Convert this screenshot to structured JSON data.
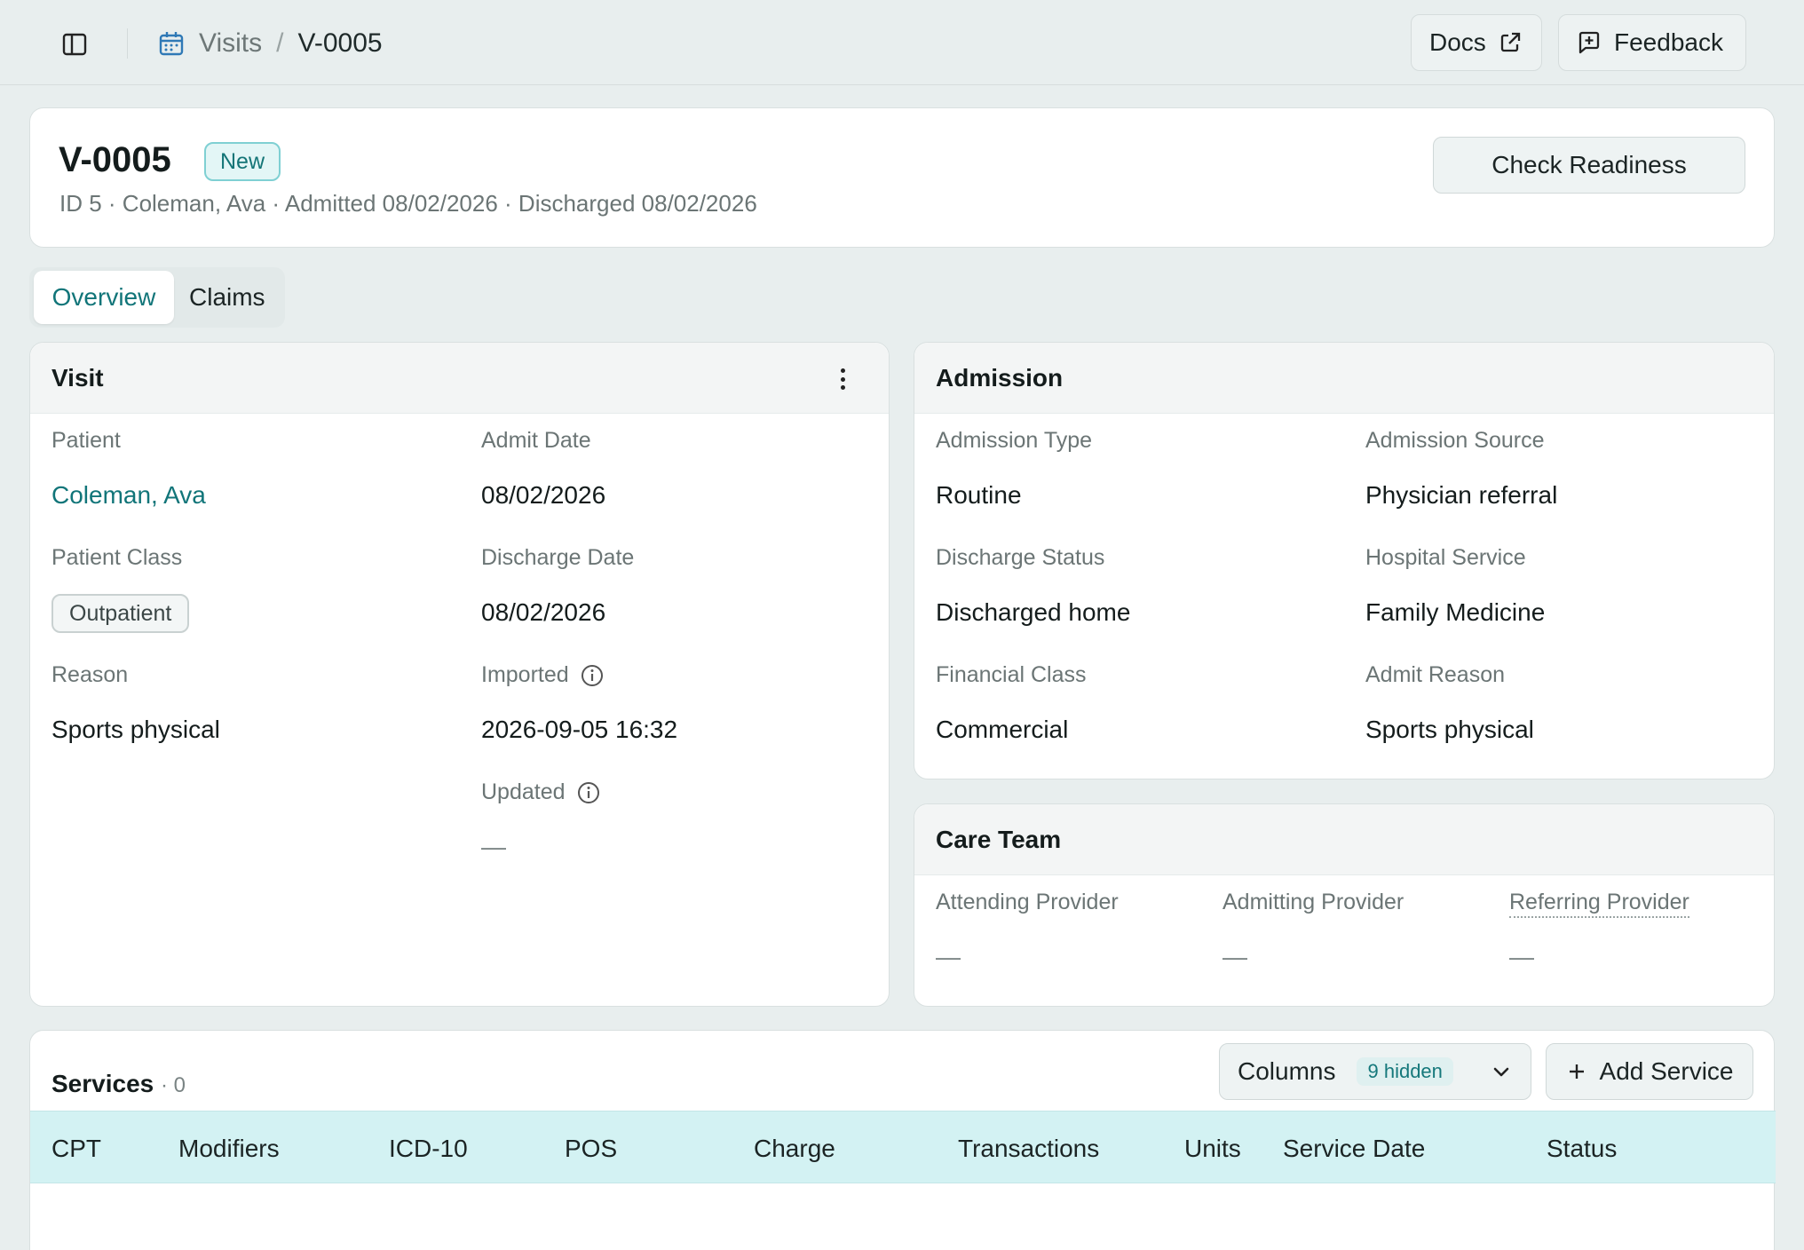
{
  "topbar": {
    "breadcrumb": {
      "section": "Visits",
      "separator": "/",
      "current": "V-0005"
    },
    "docs_label": "Docs",
    "feedback_label": "Feedback"
  },
  "header": {
    "title": "V-0005",
    "status_badge": "New",
    "subtitle": "ID 5 · Coleman, Ava · Admitted 08/02/2026 · Discharged 08/02/2026",
    "check_readiness_label": "Check Readiness"
  },
  "tabs": [
    {
      "label": "Overview",
      "active": true
    },
    {
      "label": "Claims",
      "active": false
    }
  ],
  "visit": {
    "title": "Visit",
    "patient_label": "Patient",
    "patient_value": "Coleman, Ava",
    "admit_date_label": "Admit Date",
    "admit_date_value": "08/02/2026",
    "patient_class_label": "Patient Class",
    "patient_class_value": "Outpatient",
    "discharge_date_label": "Discharge Date",
    "discharge_date_value": "08/02/2026",
    "reason_label": "Reason",
    "reason_value": "Sports physical",
    "imported_label": "Imported",
    "imported_value": "2026-09-05 16:32",
    "updated_label": "Updated",
    "updated_value": "—"
  },
  "admission": {
    "title": "Admission",
    "admission_type_label": "Admission Type",
    "admission_type_value": "Routine",
    "admission_source_label": "Admission Source",
    "admission_source_value": "Physician referral",
    "discharge_status_label": "Discharge Status",
    "discharge_status_value": "Discharged home",
    "hospital_service_label": "Hospital Service",
    "hospital_service_value": "Family Medicine",
    "financial_class_label": "Financial Class",
    "financial_class_value": "Commercial",
    "admit_reason_label": "Admit Reason",
    "admit_reason_value": "Sports physical"
  },
  "care_team": {
    "title": "Care Team",
    "attending_label": "Attending Provider",
    "attending_value": "—",
    "admitting_label": "Admitting Provider",
    "admitting_value": "—",
    "referring_label": "Referring Provider",
    "referring_value": "—"
  },
  "services": {
    "title": "Services",
    "count": "· 0",
    "columns_label": "Columns",
    "hidden_badge": "9 hidden",
    "add_label": "Add Service",
    "columns": [
      "CPT",
      "Modifiers",
      "ICD-10",
      "POS",
      "Charge",
      "Transactions",
      "Units",
      "Service Date",
      "Status"
    ]
  },
  "colors": {
    "accent": "#117579",
    "header_row": "#d3f2f3",
    "page_bg": "#e8eeee"
  }
}
